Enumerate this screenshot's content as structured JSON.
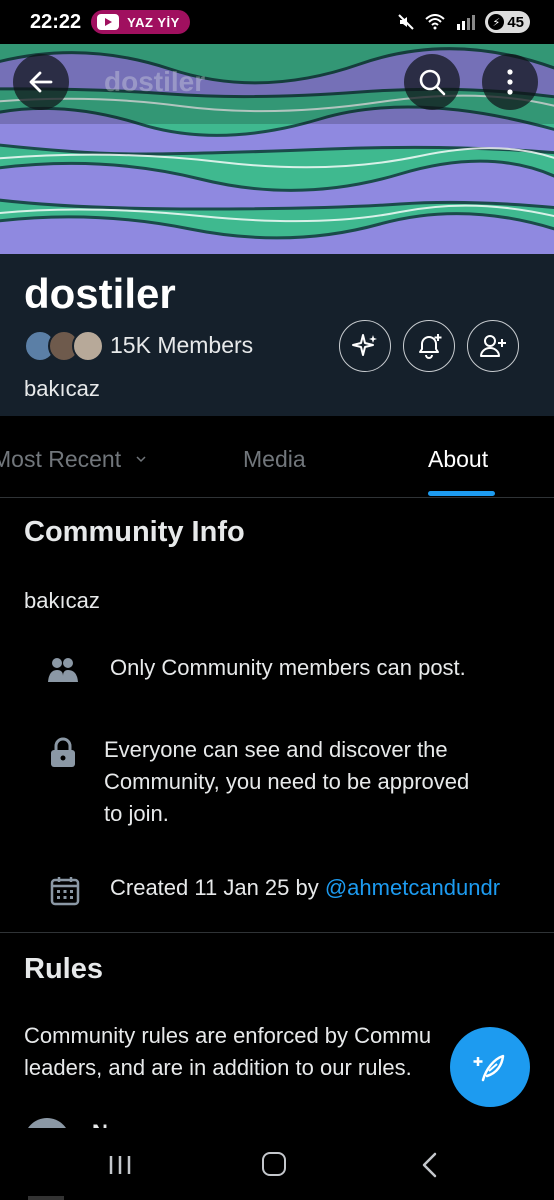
{
  "status_bar": {
    "time": "22:22",
    "yt_pill_text": "YAZ YİY",
    "battery": "45"
  },
  "topbar": {
    "title": "dostiler"
  },
  "community": {
    "name": "dostiler",
    "members": "15K Members",
    "description": "bakıcaz"
  },
  "tabs": [
    {
      "label": "Most Recent"
    },
    {
      "label": "Media"
    },
    {
      "label": "About"
    }
  ],
  "about": {
    "info_title": "Community Info",
    "info_description": "bakıcaz",
    "rows": [
      {
        "icon": "people-icon",
        "text": "Only Community members can post."
      },
      {
        "icon": "lock-icon",
        "text_lines": [
          "Everyone can see and discover the",
          "Community, you need to be approved",
          "to join."
        ]
      },
      {
        "icon": "calendar-icon",
        "text": "Created 11 Jan 25 by ",
        "link": "@ahmetcandundr"
      }
    ],
    "rules_title": "Rules",
    "rules_text_lines": [
      "Community rules are enforced by Commu",
      "leaders, and are in addition to our rules."
    ],
    "rule_peek": "N"
  },
  "colors": {
    "accent": "#1d9bf0",
    "header_bg": "#15202b",
    "background": "#000000"
  }
}
